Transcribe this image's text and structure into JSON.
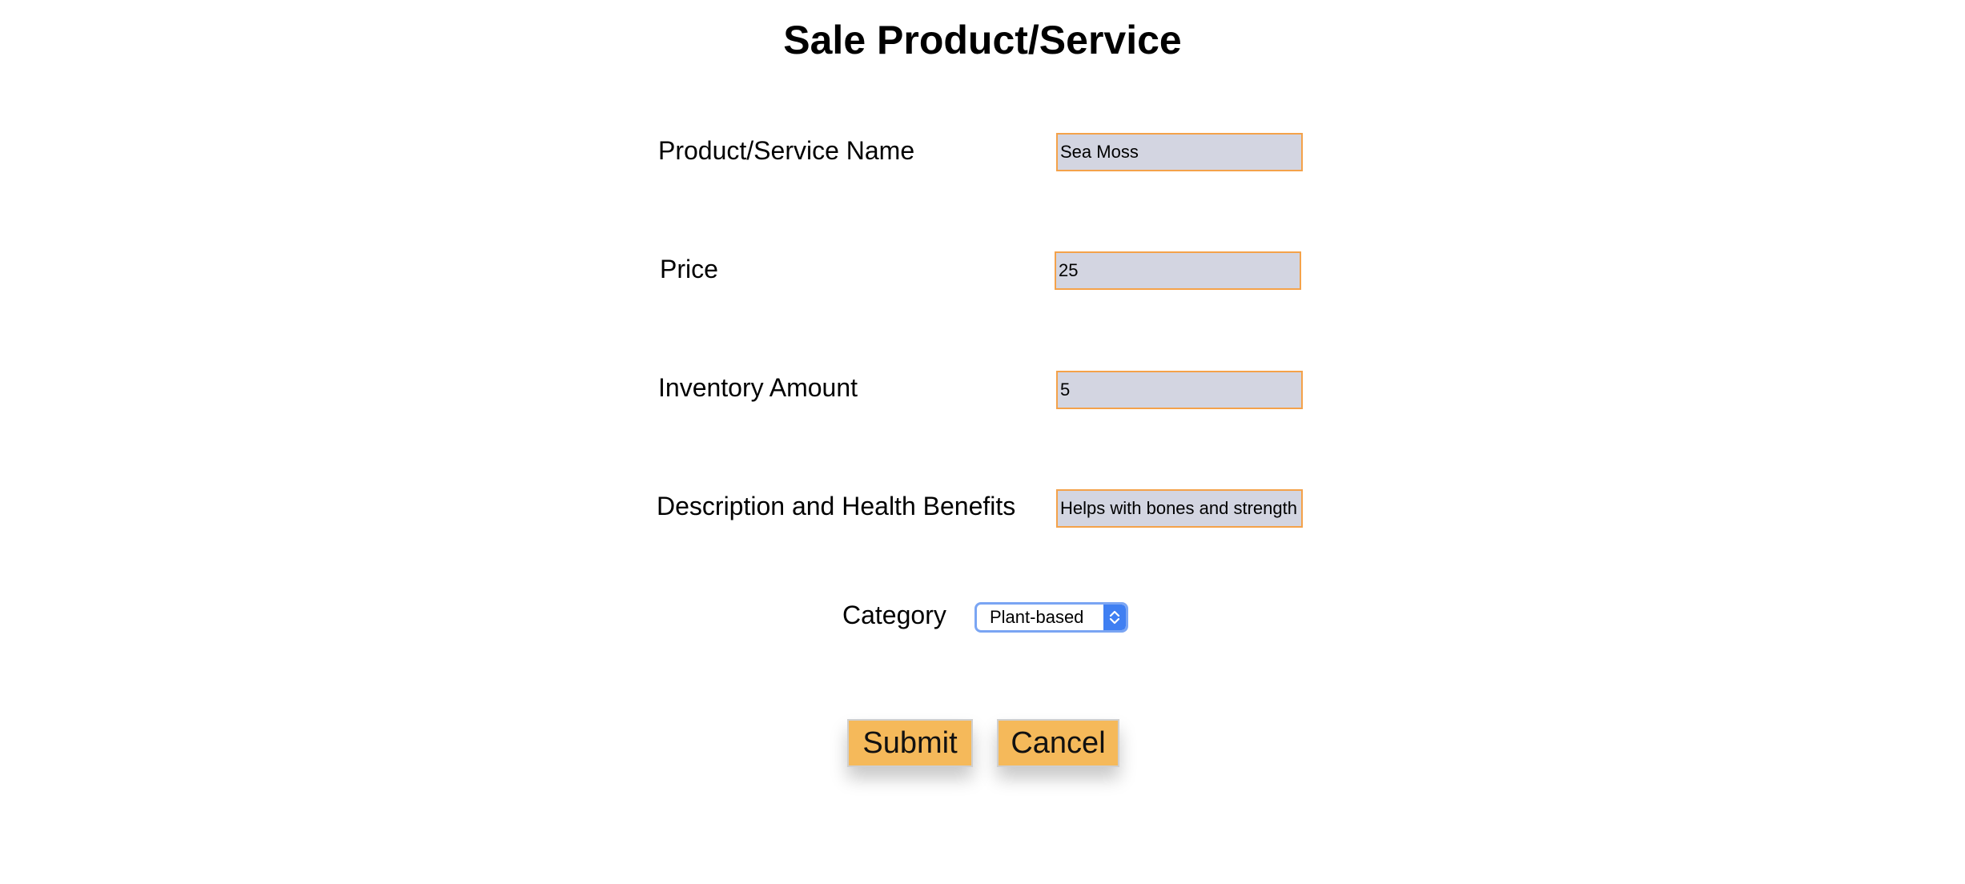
{
  "page": {
    "title": "Sale Product/Service"
  },
  "form": {
    "name": {
      "label": "Product/Service Name",
      "value": "Sea Moss"
    },
    "price": {
      "label": "Price",
      "value": "25"
    },
    "inventory": {
      "label": "Inventory Amount",
      "value": "5"
    },
    "description": {
      "label": "Description and Health Benefits",
      "value": "Helps with bones and strength"
    },
    "category": {
      "label": "Category",
      "selected": "Plant-based"
    }
  },
  "actions": {
    "submit_label": "Submit",
    "cancel_label": "Cancel"
  },
  "colors": {
    "input_border": "#f4a24a",
    "input_background": "#d3d5e1",
    "button_background": "#f5b95a",
    "select_accent": "#3f7ff2"
  }
}
